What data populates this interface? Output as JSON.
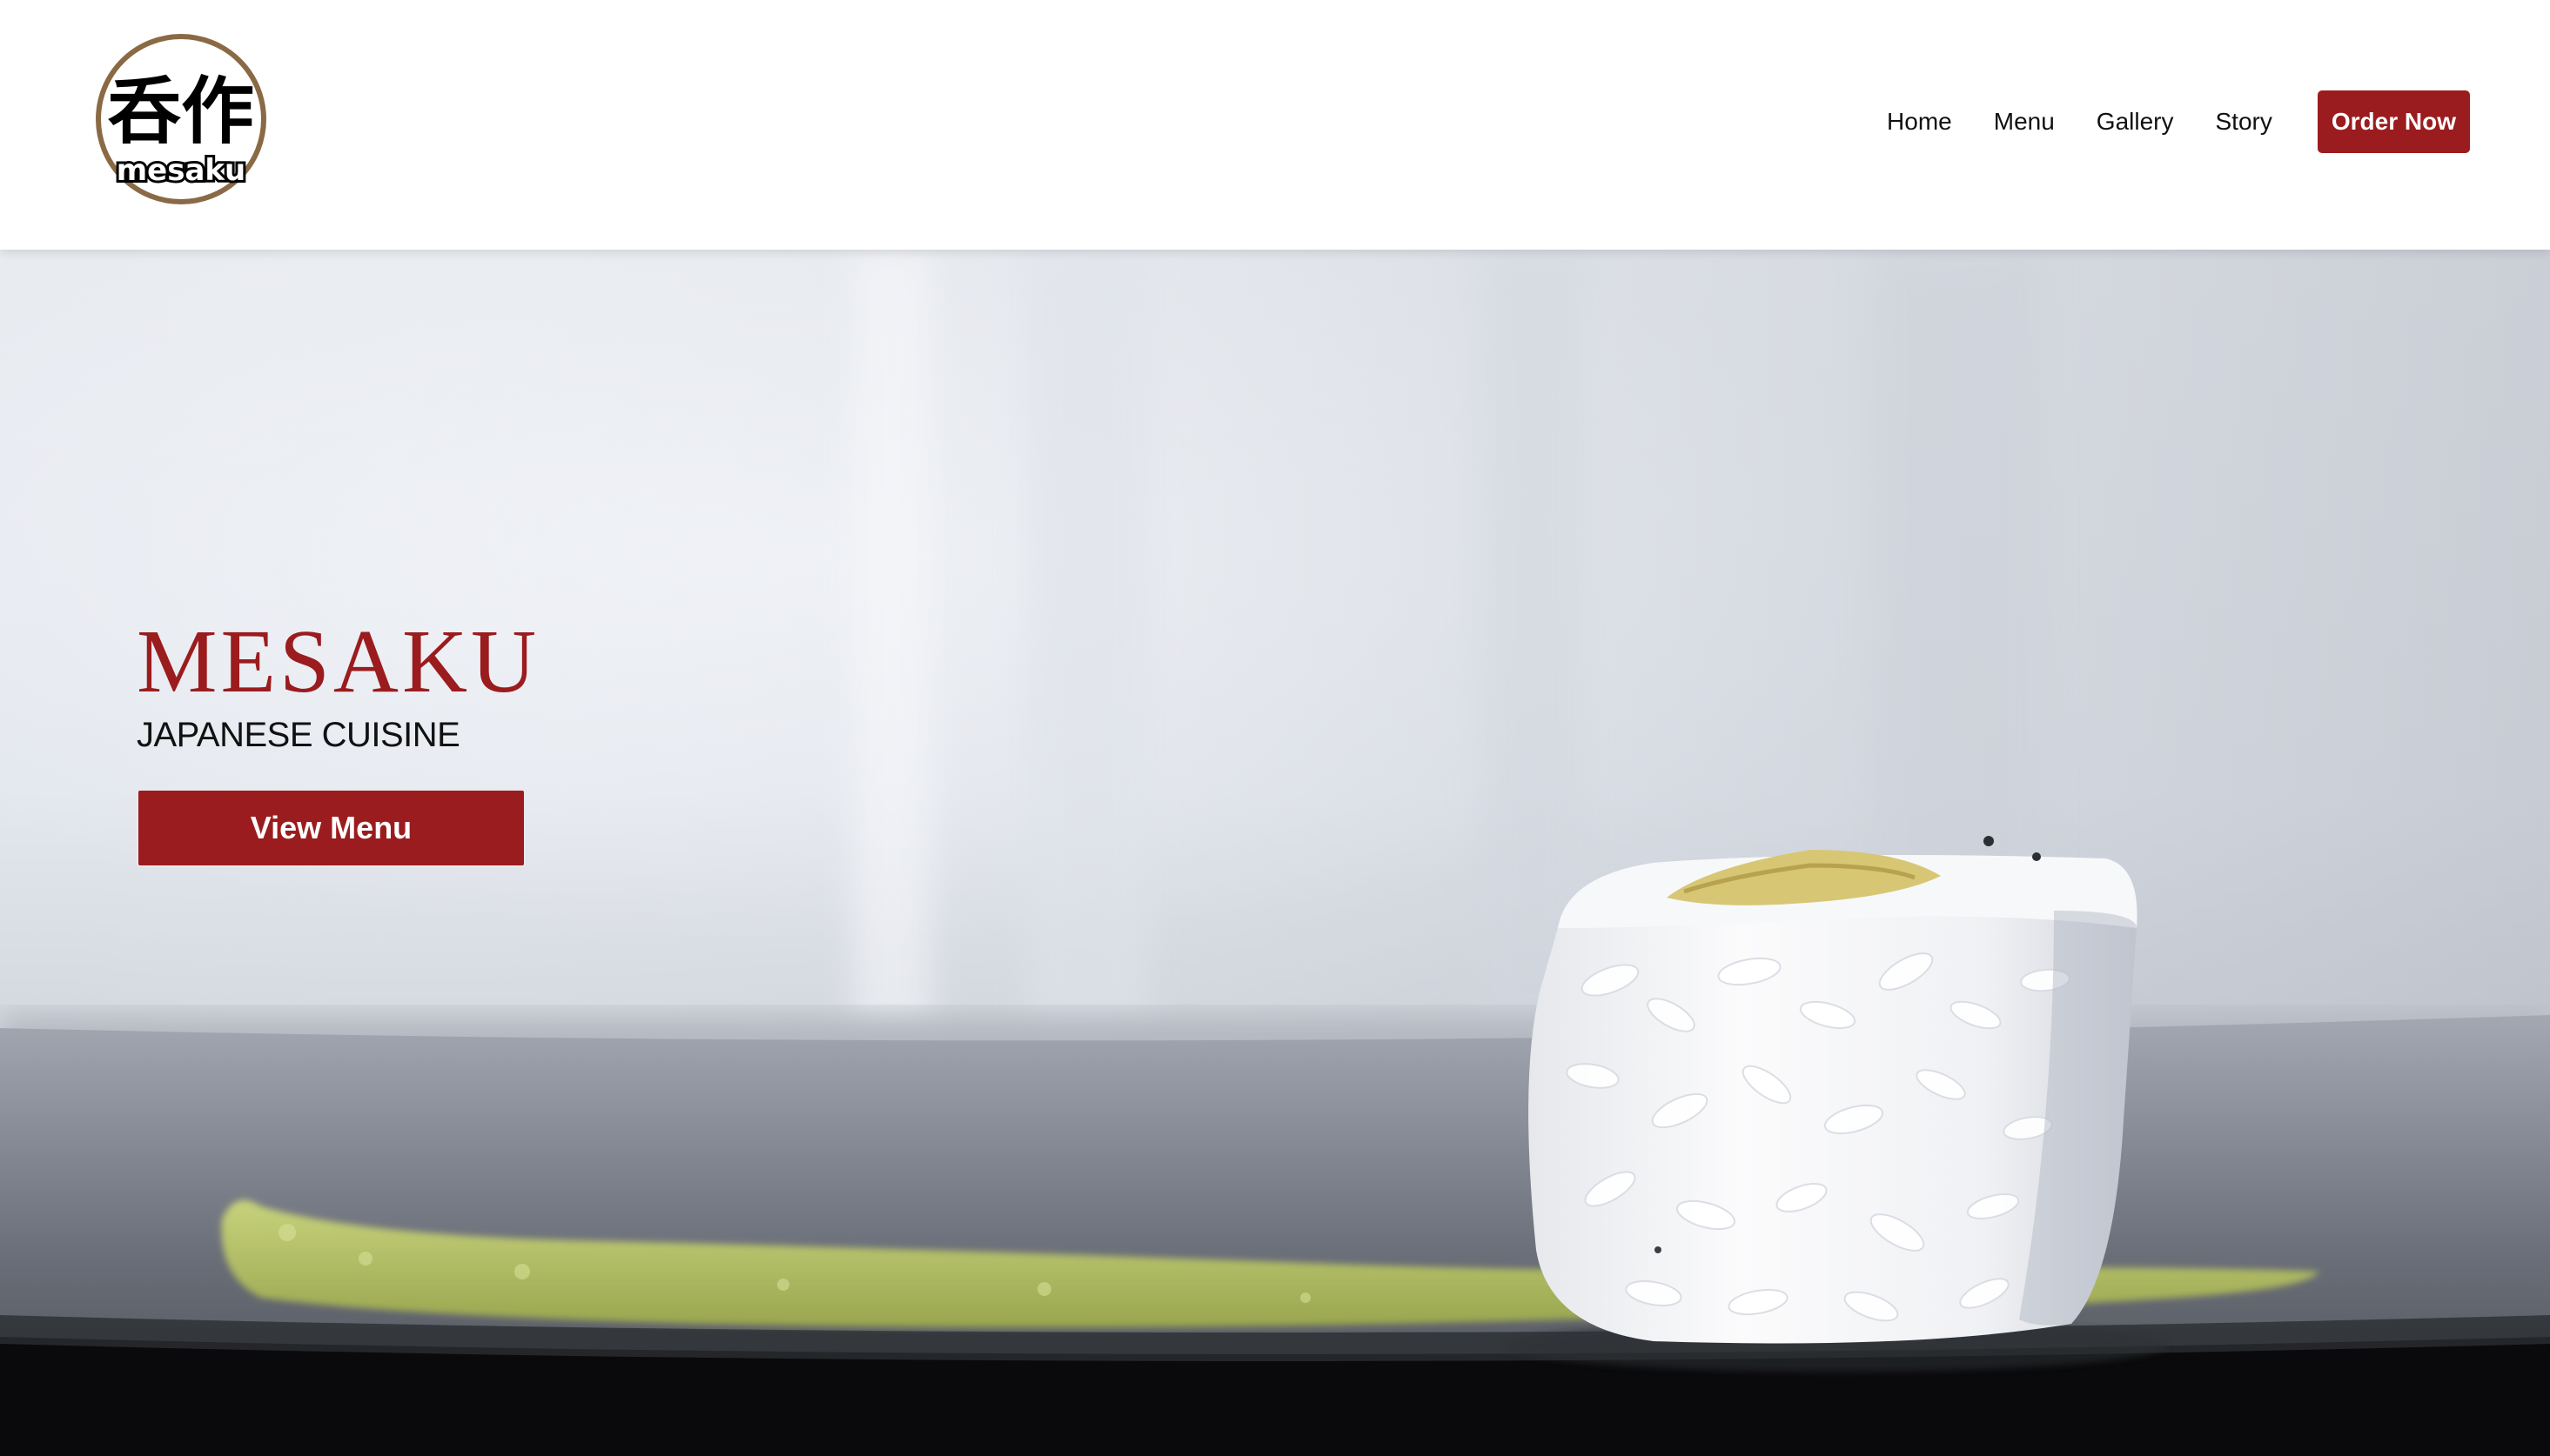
{
  "logo": {
    "kanji": "呑作",
    "wordmark": "mesaku",
    "ring_color": "#8a6a45"
  },
  "nav": {
    "links": [
      "Home",
      "Menu",
      "Gallery",
      "Story"
    ],
    "order_label": "Order Now"
  },
  "hero": {
    "title": "MESAKU",
    "subtitle": "JAPANESE CUISINE",
    "cta_label": "View Menu"
  },
  "colors": {
    "accent": "#9b1c1e",
    "nav_text": "#111111",
    "background": "#ffffff"
  },
  "icons": {
    "logo": "mesaku-logo-icon"
  }
}
